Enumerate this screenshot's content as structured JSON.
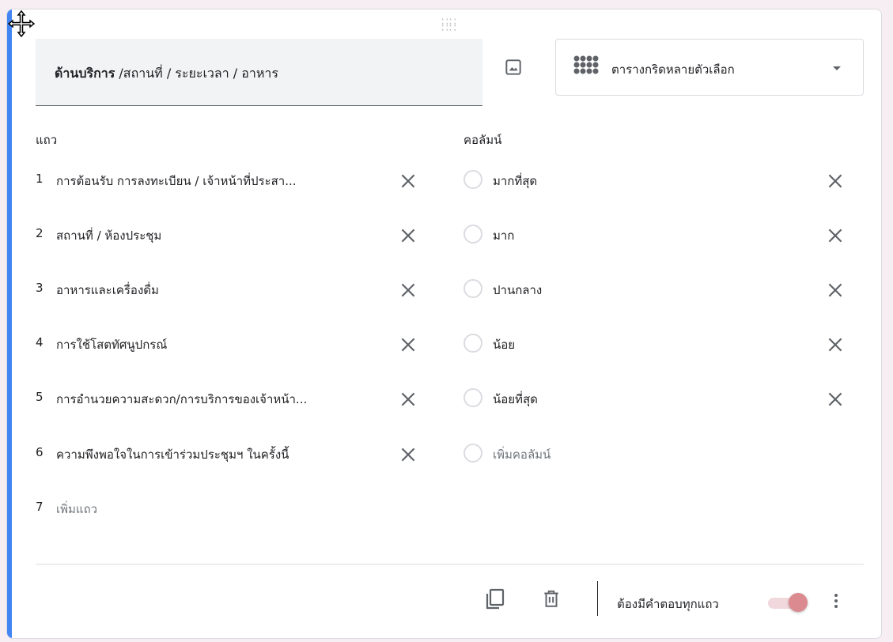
{
  "question": {
    "title_bold": "ด้านบริการ",
    "title_rest": " /สถานที่ / ระยะเวลา / อาหาร",
    "type_label": "ตารางกริดหลายตัวเลือก"
  },
  "rows_label": "แถว",
  "columns_label": "คอลัมน์",
  "rows": [
    {
      "num": "1",
      "text": "การต้อนรับ การลงทะเบียน / เจ้าหน้าที่ประสา..."
    },
    {
      "num": "2",
      "text": "สถานที่ / ห้องประชุม"
    },
    {
      "num": "3",
      "text": "อาหารและเครื่องดื่ม"
    },
    {
      "num": "4",
      "text": "การใช้โสตทัศนูปกรณ์"
    },
    {
      "num": "5",
      "text": "การอำนวยความสะดวก/การบริการของเจ้าหน้า..."
    },
    {
      "num": "6",
      "text": "ความพึงพอใจในการเข้าร่วมประชุมฯ ในครั้งนี้"
    }
  ],
  "add_row": {
    "num": "7",
    "text": "เพิ่มแถว"
  },
  "columns": [
    {
      "text": "มากที่สุด"
    },
    {
      "text": "มาก"
    },
    {
      "text": "ปานกลาง"
    },
    {
      "text": "น้อย"
    },
    {
      "text": "น้อยที่สุด"
    }
  ],
  "add_column": {
    "text": "เพิ่มคอลัมน์"
  },
  "footer": {
    "required_label": "ต้องมีคำตอบทุกแถว",
    "required_on": true
  },
  "colors": {
    "accent": "#4285f4",
    "toggle_thumb": "#db8a90",
    "toggle_track": "#f0d8dc"
  }
}
